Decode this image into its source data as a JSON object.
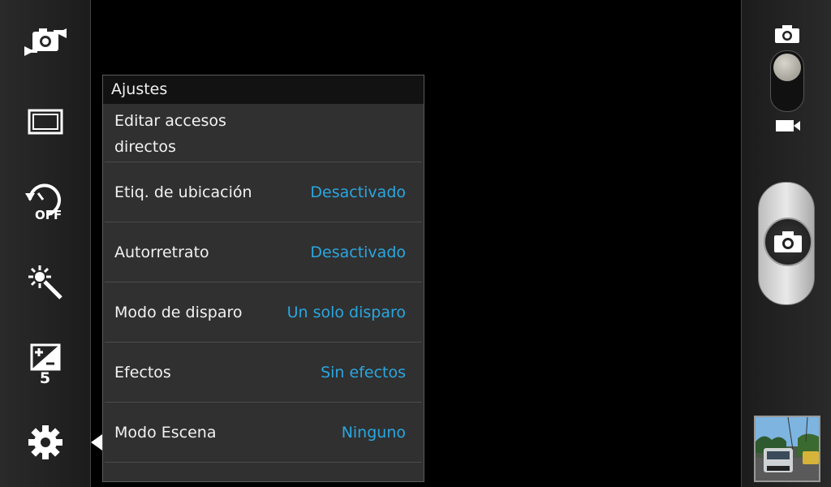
{
  "panel": {
    "title": "Ajustes",
    "items": [
      {
        "label_line1": "Editar accesos",
        "label_line2": "directos"
      },
      {
        "label": "Etiq. de ubicación",
        "value": "Desactivado"
      },
      {
        "label": "Autorretrato",
        "value": "Desactivado"
      },
      {
        "label": "Modo de disparo",
        "value": "Un solo disparo"
      },
      {
        "label": "Efectos",
        "value": "Sin efectos"
      },
      {
        "label": "Modo Escena",
        "value": "Ninguno"
      }
    ]
  },
  "left_bar": {
    "icons": [
      "switch-camera-icon",
      "photo-size-icon",
      "timer-off-icon",
      "flash-effects-icon",
      "exposure-icon",
      "settings-icon"
    ],
    "exposure_value": "5"
  },
  "right_bar": {
    "icons": [
      "camera-mode-icon",
      "video-mode-icon",
      "shutter-camera-icon",
      "gallery-thumbnail"
    ]
  },
  "colors": {
    "accent": "#2aa7e0",
    "panel_bg": "#303030",
    "title_bg": "#121212"
  }
}
